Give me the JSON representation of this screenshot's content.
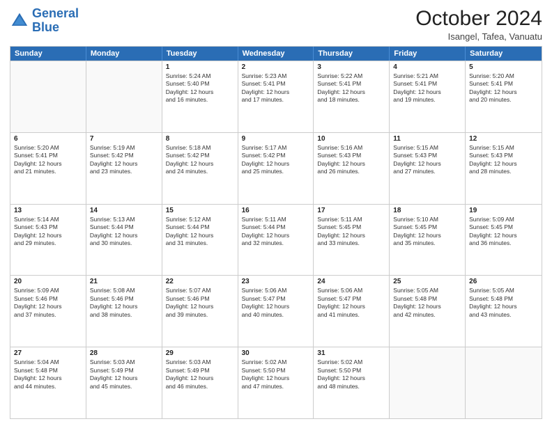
{
  "logo": {
    "text_general": "General",
    "text_blue": "Blue"
  },
  "title": "October 2024",
  "location": "Isangel, Tafea, Vanuatu",
  "header": {
    "days": [
      "Sunday",
      "Monday",
      "Tuesday",
      "Wednesday",
      "Thursday",
      "Friday",
      "Saturday"
    ]
  },
  "rows": [
    [
      {
        "day": "",
        "lines": [],
        "empty": true
      },
      {
        "day": "",
        "lines": [],
        "empty": true
      },
      {
        "day": "1",
        "lines": [
          "Sunrise: 5:24 AM",
          "Sunset: 5:40 PM",
          "Daylight: 12 hours",
          "and 16 minutes."
        ]
      },
      {
        "day": "2",
        "lines": [
          "Sunrise: 5:23 AM",
          "Sunset: 5:41 PM",
          "Daylight: 12 hours",
          "and 17 minutes."
        ]
      },
      {
        "day": "3",
        "lines": [
          "Sunrise: 5:22 AM",
          "Sunset: 5:41 PM",
          "Daylight: 12 hours",
          "and 18 minutes."
        ]
      },
      {
        "day": "4",
        "lines": [
          "Sunrise: 5:21 AM",
          "Sunset: 5:41 PM",
          "Daylight: 12 hours",
          "and 19 minutes."
        ]
      },
      {
        "day": "5",
        "lines": [
          "Sunrise: 5:20 AM",
          "Sunset: 5:41 PM",
          "Daylight: 12 hours",
          "and 20 minutes."
        ]
      }
    ],
    [
      {
        "day": "6",
        "lines": [
          "Sunrise: 5:20 AM",
          "Sunset: 5:41 PM",
          "Daylight: 12 hours",
          "and 21 minutes."
        ]
      },
      {
        "day": "7",
        "lines": [
          "Sunrise: 5:19 AM",
          "Sunset: 5:42 PM",
          "Daylight: 12 hours",
          "and 23 minutes."
        ]
      },
      {
        "day": "8",
        "lines": [
          "Sunrise: 5:18 AM",
          "Sunset: 5:42 PM",
          "Daylight: 12 hours",
          "and 24 minutes."
        ]
      },
      {
        "day": "9",
        "lines": [
          "Sunrise: 5:17 AM",
          "Sunset: 5:42 PM",
          "Daylight: 12 hours",
          "and 25 minutes."
        ]
      },
      {
        "day": "10",
        "lines": [
          "Sunrise: 5:16 AM",
          "Sunset: 5:43 PM",
          "Daylight: 12 hours",
          "and 26 minutes."
        ]
      },
      {
        "day": "11",
        "lines": [
          "Sunrise: 5:15 AM",
          "Sunset: 5:43 PM",
          "Daylight: 12 hours",
          "and 27 minutes."
        ]
      },
      {
        "day": "12",
        "lines": [
          "Sunrise: 5:15 AM",
          "Sunset: 5:43 PM",
          "Daylight: 12 hours",
          "and 28 minutes."
        ]
      }
    ],
    [
      {
        "day": "13",
        "lines": [
          "Sunrise: 5:14 AM",
          "Sunset: 5:43 PM",
          "Daylight: 12 hours",
          "and 29 minutes."
        ]
      },
      {
        "day": "14",
        "lines": [
          "Sunrise: 5:13 AM",
          "Sunset: 5:44 PM",
          "Daylight: 12 hours",
          "and 30 minutes."
        ]
      },
      {
        "day": "15",
        "lines": [
          "Sunrise: 5:12 AM",
          "Sunset: 5:44 PM",
          "Daylight: 12 hours",
          "and 31 minutes."
        ]
      },
      {
        "day": "16",
        "lines": [
          "Sunrise: 5:11 AM",
          "Sunset: 5:44 PM",
          "Daylight: 12 hours",
          "and 32 minutes."
        ]
      },
      {
        "day": "17",
        "lines": [
          "Sunrise: 5:11 AM",
          "Sunset: 5:45 PM",
          "Daylight: 12 hours",
          "and 33 minutes."
        ]
      },
      {
        "day": "18",
        "lines": [
          "Sunrise: 5:10 AM",
          "Sunset: 5:45 PM",
          "Daylight: 12 hours",
          "and 35 minutes."
        ]
      },
      {
        "day": "19",
        "lines": [
          "Sunrise: 5:09 AM",
          "Sunset: 5:45 PM",
          "Daylight: 12 hours",
          "and 36 minutes."
        ]
      }
    ],
    [
      {
        "day": "20",
        "lines": [
          "Sunrise: 5:09 AM",
          "Sunset: 5:46 PM",
          "Daylight: 12 hours",
          "and 37 minutes."
        ]
      },
      {
        "day": "21",
        "lines": [
          "Sunrise: 5:08 AM",
          "Sunset: 5:46 PM",
          "Daylight: 12 hours",
          "and 38 minutes."
        ]
      },
      {
        "day": "22",
        "lines": [
          "Sunrise: 5:07 AM",
          "Sunset: 5:46 PM",
          "Daylight: 12 hours",
          "and 39 minutes."
        ]
      },
      {
        "day": "23",
        "lines": [
          "Sunrise: 5:06 AM",
          "Sunset: 5:47 PM",
          "Daylight: 12 hours",
          "and 40 minutes."
        ]
      },
      {
        "day": "24",
        "lines": [
          "Sunrise: 5:06 AM",
          "Sunset: 5:47 PM",
          "Daylight: 12 hours",
          "and 41 minutes."
        ]
      },
      {
        "day": "25",
        "lines": [
          "Sunrise: 5:05 AM",
          "Sunset: 5:48 PM",
          "Daylight: 12 hours",
          "and 42 minutes."
        ]
      },
      {
        "day": "26",
        "lines": [
          "Sunrise: 5:05 AM",
          "Sunset: 5:48 PM",
          "Daylight: 12 hours",
          "and 43 minutes."
        ]
      }
    ],
    [
      {
        "day": "27",
        "lines": [
          "Sunrise: 5:04 AM",
          "Sunset: 5:48 PM",
          "Daylight: 12 hours",
          "and 44 minutes."
        ]
      },
      {
        "day": "28",
        "lines": [
          "Sunrise: 5:03 AM",
          "Sunset: 5:49 PM",
          "Daylight: 12 hours",
          "and 45 minutes."
        ]
      },
      {
        "day": "29",
        "lines": [
          "Sunrise: 5:03 AM",
          "Sunset: 5:49 PM",
          "Daylight: 12 hours",
          "and 46 minutes."
        ]
      },
      {
        "day": "30",
        "lines": [
          "Sunrise: 5:02 AM",
          "Sunset: 5:50 PM",
          "Daylight: 12 hours",
          "and 47 minutes."
        ]
      },
      {
        "day": "31",
        "lines": [
          "Sunrise: 5:02 AM",
          "Sunset: 5:50 PM",
          "Daylight: 12 hours",
          "and 48 minutes."
        ]
      },
      {
        "day": "",
        "lines": [],
        "empty": true
      },
      {
        "day": "",
        "lines": [],
        "empty": true
      }
    ]
  ]
}
